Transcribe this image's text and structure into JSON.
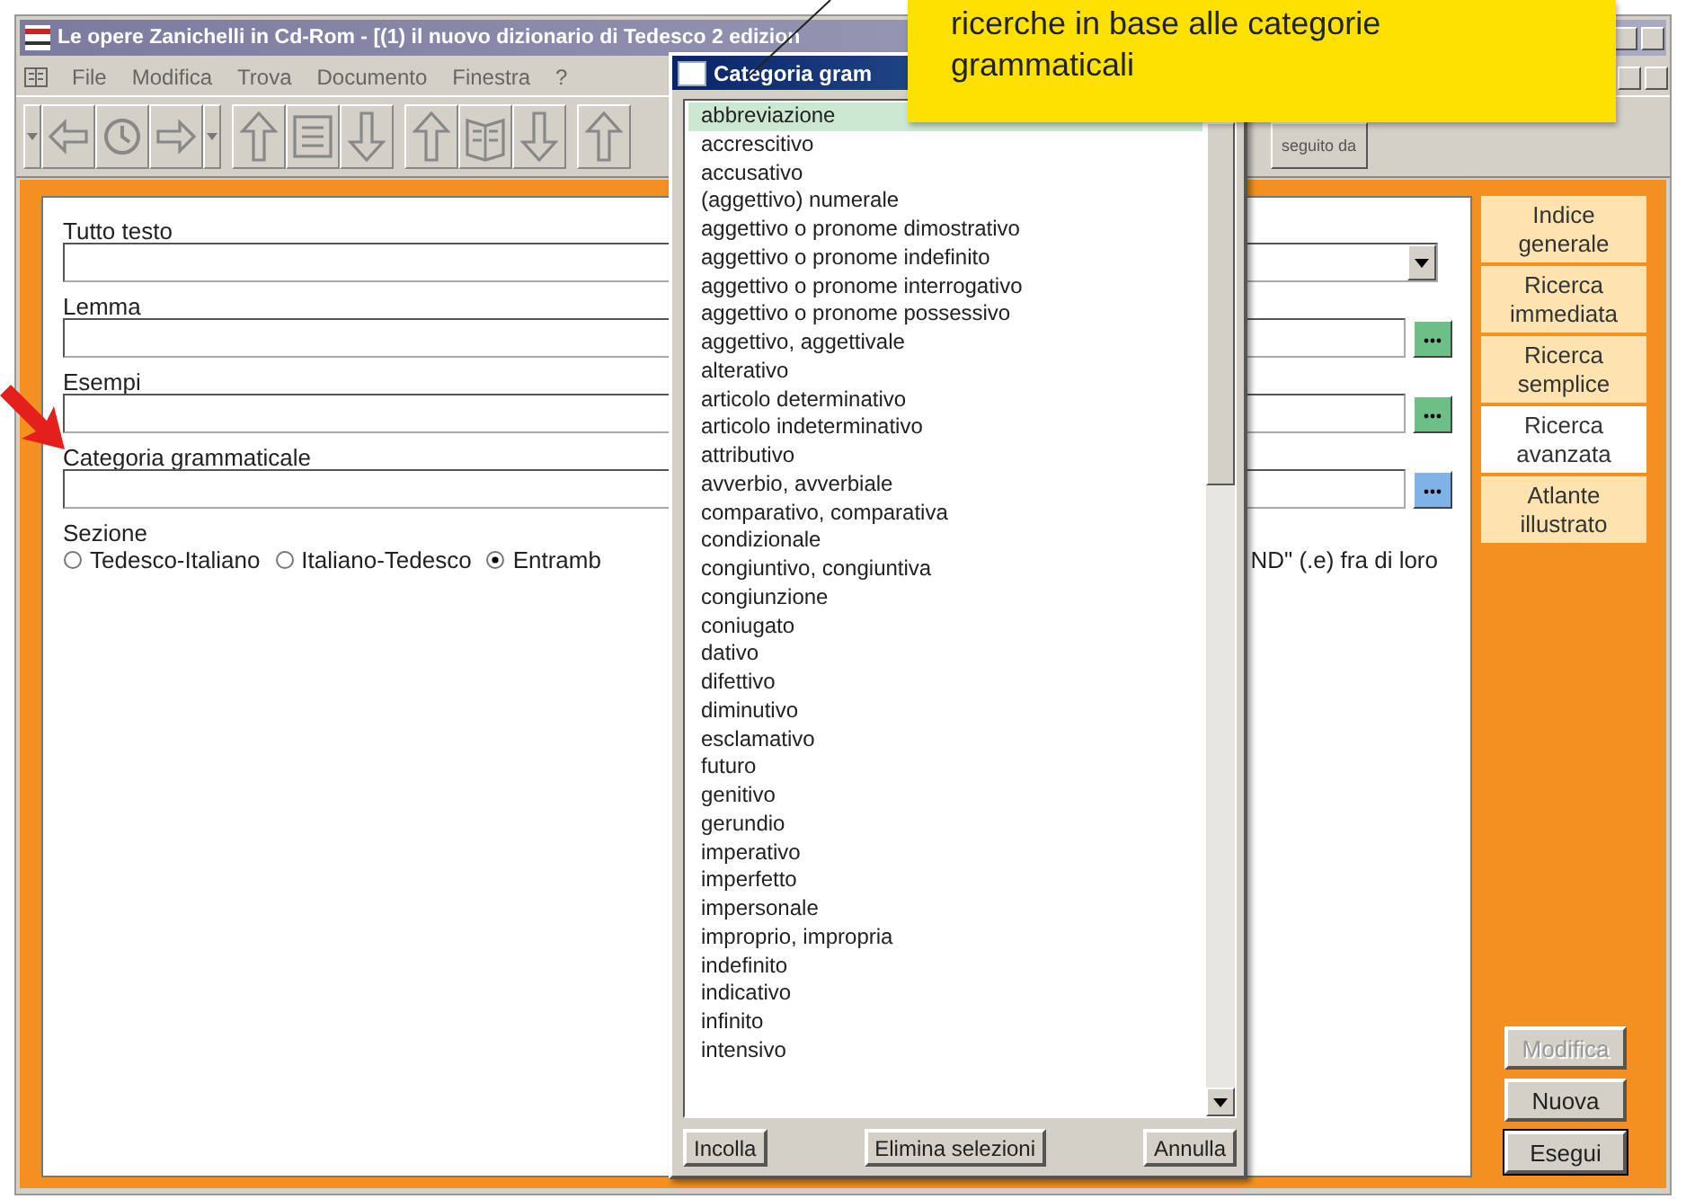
{
  "window": {
    "title": "Le opere Zanichelli in Cd-Rom - [(1) il nuovo dizionario di Tedesco 2 edizion"
  },
  "menu": [
    "File",
    "Modifica",
    "Trova",
    "Documento",
    "Finestra",
    "?"
  ],
  "toolbar": {
    "text_button": "seguito da"
  },
  "form": {
    "fields": [
      {
        "label": "Tutto testo",
        "kind": "dropdown"
      },
      {
        "label": "Lemma",
        "kind": "picker",
        "color": "#6cbf86"
      },
      {
        "label": "Esempi",
        "kind": "picker",
        "color": "#6cbf86"
      },
      {
        "label": "Categoria grammaticale",
        "kind": "picker",
        "color": "#7fb2e6"
      }
    ],
    "section": {
      "label": "Sezione",
      "options": [
        {
          "label": "Tedesco-Italiano",
          "selected": false
        },
        {
          "label": "Italiano-Tedesco",
          "selected": false
        },
        {
          "label": "Entramb",
          "selected": true
        }
      ],
      "note": "ND\" (.e) fra di loro"
    }
  },
  "side_tabs": [
    {
      "label": "Indice generale",
      "selected": false
    },
    {
      "label": "Ricerca immediata",
      "selected": false
    },
    {
      "label": "Ricerca semplice",
      "selected": false
    },
    {
      "label": "Ricerca avanzata",
      "selected": true
    },
    {
      "label": "Atlante illustrato",
      "selected": false
    }
  ],
  "actions": [
    {
      "label": "Modifica",
      "disabled": true,
      "default": false
    },
    {
      "label": "Nuova",
      "disabled": false,
      "default": false
    },
    {
      "label": "Esegui",
      "disabled": false,
      "default": true
    }
  ],
  "dialog": {
    "title": "Categoria gram",
    "items": [
      {
        "label": "abbreviazione",
        "selected": true
      },
      {
        "label": "accrescitivo",
        "selected": false
      },
      {
        "label": "accusativo",
        "selected": false
      },
      {
        "label": "(aggettivo) numerale",
        "selected": false
      },
      {
        "label": "aggettivo o pronome dimostrativo",
        "selected": false
      },
      {
        "label": "aggettivo o pronome indefinito",
        "selected": false
      },
      {
        "label": "aggettivo o pronome interrogativo",
        "selected": false
      },
      {
        "label": "aggettivo o pronome possessivo",
        "selected": false
      },
      {
        "label": "aggettivo, aggettivale",
        "selected": false
      },
      {
        "label": "alterativo",
        "selected": false
      },
      {
        "label": "articolo determinativo",
        "selected": false
      },
      {
        "label": "articolo indeterminativo",
        "selected": false
      },
      {
        "label": "attributivo",
        "selected": false
      },
      {
        "label": "avverbio, avverbiale",
        "selected": false
      },
      {
        "label": "comparativo, comparativa",
        "selected": false
      },
      {
        "label": "condizionale",
        "selected": false
      },
      {
        "label": "congiuntivo, congiuntiva",
        "selected": false
      },
      {
        "label": "congiunzione",
        "selected": false
      },
      {
        "label": "coniugato",
        "selected": false
      },
      {
        "label": "dativo",
        "selected": false
      },
      {
        "label": "difettivo",
        "selected": false
      },
      {
        "label": "diminutivo",
        "selected": false
      },
      {
        "label": "esclamativo",
        "selected": false
      },
      {
        "label": "futuro",
        "selected": false
      },
      {
        "label": "genitivo",
        "selected": false
      },
      {
        "label": "gerundio",
        "selected": false
      },
      {
        "label": "imperativo",
        "selected": false
      },
      {
        "label": "imperfetto",
        "selected": false
      },
      {
        "label": "impersonale",
        "selected": false
      },
      {
        "label": "improprio, impropria",
        "selected": false
      },
      {
        "label": "indefinito",
        "selected": false
      },
      {
        "label": "indicativo",
        "selected": false
      },
      {
        "label": "infinito",
        "selected": false
      },
      {
        "label": "intensivo",
        "selected": false
      }
    ],
    "buttons": [
      "Incolla",
      "Elimina selezioni",
      "Annulla"
    ]
  },
  "callout": {
    "text": "ricerche in base alle categorie grammaticali"
  }
}
